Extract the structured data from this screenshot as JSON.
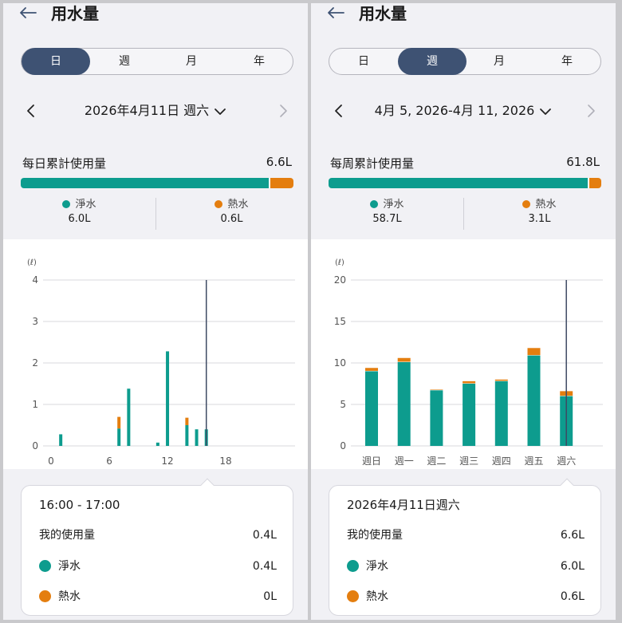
{
  "colors": {
    "pure": "#0d9c8e",
    "hot": "#e47e0f",
    "cursor": "#3e4a63",
    "grid": "#dadade",
    "axis": "#555555"
  },
  "day": {
    "title": "用水量",
    "tabs": [
      "日",
      "週",
      "月",
      "年"
    ],
    "active_tab": 0,
    "period_label": "2026年4月11日 週六",
    "total_label": "每日累計使用量",
    "total_value": "6.6L",
    "pure_fraction": 0.909,
    "pure_label": "淨水",
    "pure_value": "6.0L",
    "hot_label": "熱水",
    "hot_value": "0.6L",
    "tooltip": {
      "title": "16:00 - 17:00",
      "mine_label": "我的使用量",
      "mine_value": "0.4L",
      "pure_label": "淨水",
      "pure_value": "0.4L",
      "hot_label": "熱水",
      "hot_value": "0L"
    }
  },
  "week": {
    "title": "用水量",
    "tabs": [
      "日",
      "週",
      "月",
      "年"
    ],
    "active_tab": 1,
    "period_label": "4月 5, 2026-4月 11, 2026",
    "total_label": "每周累計使用量",
    "total_value": "61.8L",
    "pure_fraction": 0.95,
    "pure_label": "淨水",
    "pure_value": "58.7L",
    "hot_label": "熱水",
    "hot_value": "3.1L",
    "tooltip": {
      "title": "2026年4月11日週六",
      "mine_label": "我的使用量",
      "mine_value": "6.6L",
      "pure_label": "淨水",
      "pure_value": "6.0L",
      "hot_label": "熱水",
      "hot_value": "0.6L"
    }
  },
  "chart_data": [
    {
      "type": "bar",
      "stacked": true,
      "unit_label": "(ℓ)",
      "x": [
        1,
        7,
        8,
        11,
        12,
        14,
        15,
        16
      ],
      "x_ticks": [
        "0",
        "6",
        "12",
        "18"
      ],
      "x_tick_values": [
        0,
        6,
        12,
        18
      ],
      "xlim": [
        0,
        24
      ],
      "y_ticks": [
        "0",
        "1",
        "2",
        "3",
        "4"
      ],
      "ylim": [
        0,
        4
      ],
      "series": [
        {
          "values": [
            0.28,
            0.42,
            1.38,
            0.08,
            2.28,
            0.5,
            0.4,
            0.4
          ]
        },
        {
          "values": [
            0,
            0.28,
            0,
            0,
            0,
            0.18,
            0,
            0
          ]
        }
      ],
      "selected_x": 16,
      "grid": true
    },
    {
      "type": "bar",
      "stacked": true,
      "unit_label": "(ℓ)",
      "categories": [
        "週日",
        "週一",
        "週二",
        "週三",
        "週四",
        "週五",
        "週六"
      ],
      "y_ticks": [
        "0",
        "5",
        "10",
        "15",
        "20"
      ],
      "ylim": [
        0,
        20
      ],
      "series": [
        {
          "values": [
            9.0,
            10.1,
            6.7,
            7.5,
            7.8,
            10.9,
            6.0
          ]
        },
        {
          "values": [
            0.4,
            0.5,
            0.1,
            0.3,
            0.2,
            0.9,
            0.6
          ]
        }
      ],
      "selected_index": 6,
      "grid": true
    }
  ]
}
